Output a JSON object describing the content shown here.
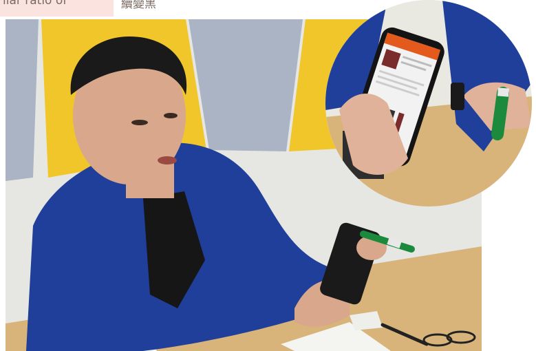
{
  "caption": {
    "left_text": "ilar ratio of",
    "right_text": "續變黑"
  },
  "colors": {
    "caption_bg": "#fbe3df",
    "wall": "#e6e7e2",
    "yellow_panel": "#f0c62a",
    "grey_panel": "#aab4c4",
    "jacket": "#1f3f9a",
    "desk": "#d8b47a",
    "phone": "#1a1a1a",
    "pen_green": "#1c8a3c"
  },
  "scene": {
    "main_photo": "man in blue blazer scanning a green pen with smartphone at desk",
    "inset_photo": "close-up of phone app screen showing pen product and green pen"
  }
}
